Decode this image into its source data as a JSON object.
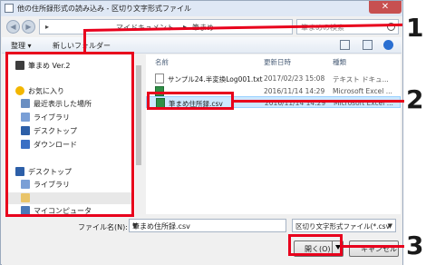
{
  "window": {
    "title": "他の住所録形式の読み込み - 区切り文字形式ファイル",
    "close_label": "✕"
  },
  "address": {
    "path": [
      "マイドキュメント",
      "筆まめ"
    ],
    "search_placeholder": "筆まめの検索"
  },
  "toolbar": {
    "organize_label": "整理 ▾",
    "new_folder_label": "新しいフォルダー"
  },
  "nav_pane": {
    "items": [
      {
        "label": "筆まめ Ver.2",
        "icon": "app-icon"
      },
      {
        "label": "お気に入り",
        "icon": "star-icon"
      },
      {
        "label": "最近表示した場所",
        "icon": "recent-icon"
      },
      {
        "label": "ライブラリ",
        "icon": "library-icon"
      },
      {
        "label": "デスクトップ",
        "icon": "desktop-icon"
      },
      {
        "label": "ダウンロード",
        "icon": "download-icon"
      },
      {
        "label": "デスクトップ",
        "icon": "desktop-icon"
      },
      {
        "label": "ライブラリ",
        "icon": "library-icon"
      },
      {
        "label": "",
        "icon": "user-folder-icon"
      },
      {
        "label": "マイコンピュータ",
        "icon": "computer-icon"
      }
    ]
  },
  "file_pane": {
    "columns": [
      "名前",
      "更新日時",
      "種類"
    ],
    "rows": [
      {
        "name": "サンプル24.半変換Log001.txt",
        "date": "2017/02/23 15:08",
        "type": "テキスト ドキュ..."
      },
      {
        "name": "",
        "date": "2016/11/14 14:29",
        "type": "Microsoft Excel ..."
      },
      {
        "name": "筆まめ住所録.csv",
        "date": "2016/11/14 14:29",
        "type": "Microsoft Excel ..."
      }
    ]
  },
  "bottom": {
    "filename_label": "ファイル名(N):",
    "filename_value": "筆まめ住所録.csv",
    "filetype_value": "区切り文字形式ファイル(*.csv",
    "open_label": "開く(O)",
    "cancel_label": "キャンセル"
  },
  "callouts": [
    "1",
    "2",
    "3"
  ],
  "colors": {
    "highlight": "#e8001c",
    "selection": "#cde8ff"
  }
}
